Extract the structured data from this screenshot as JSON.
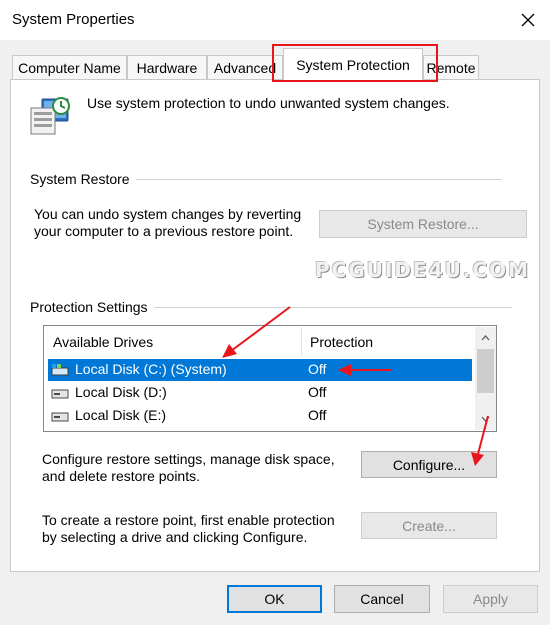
{
  "window": {
    "title": "System Properties",
    "close_glyph": "✕"
  },
  "tabs": [
    {
      "label": "Computer Name",
      "active": false
    },
    {
      "label": "Hardware",
      "active": false
    },
    {
      "label": "Advanced",
      "active": false
    },
    {
      "label": "System Protection",
      "active": true
    },
    {
      "label": "Remote",
      "active": false
    }
  ],
  "intro": {
    "text": "Use system protection to undo unwanted system changes.",
    "icon": "system-protection-icon"
  },
  "system_restore": {
    "heading": "System Restore",
    "description_line1": "You can undo system changes by reverting",
    "description_line2": "your computer to a previous restore point.",
    "button_label": "System Restore..."
  },
  "watermark": "PCGUIDE4U.COM",
  "protection": {
    "heading": "Protection Settings",
    "columns": [
      "Available Drives",
      "Protection"
    ],
    "drives": [
      {
        "name": "Local Disk (C:) (System)",
        "protection": "Off",
        "selected": true,
        "icon": "system-drive-icon"
      },
      {
        "name": "Local Disk (D:)",
        "protection": "Off",
        "selected": false,
        "icon": "drive-icon"
      },
      {
        "name": "Local Disk (E:)",
        "protection": "Off",
        "selected": false,
        "icon": "drive-icon"
      }
    ],
    "configure_text_line1": "Configure restore settings, manage disk space,",
    "configure_text_line2": "and delete restore points.",
    "configure_button": "Configure...",
    "create_text_line1": "To create a restore point, first enable protection",
    "create_text_line2": "by selecting a drive and clicking Configure.",
    "create_button": "Create..."
  },
  "footer": {
    "ok": "OK",
    "cancel": "Cancel",
    "apply": "Apply"
  },
  "colors": {
    "selection": "#0078d7",
    "annotation": "#e8161a"
  }
}
